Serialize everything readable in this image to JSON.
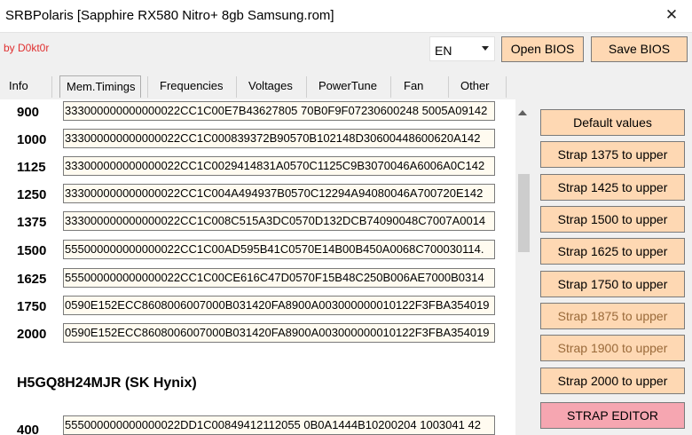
{
  "window": {
    "title": "SRBPolaris [Sapphire RX580 Nitro+ 8gb  Samsung.rom]",
    "close_glyph": "✕"
  },
  "header": {
    "author": "by D0kt0r",
    "language": "EN",
    "open_bios": "Open BIOS",
    "save_bios": "Save BIOS"
  },
  "tabs": [
    {
      "label": "Info",
      "active": false
    },
    {
      "label": "Mem.Timings",
      "active": true
    },
    {
      "label": "Frequencies",
      "active": false
    },
    {
      "label": "Voltages",
      "active": false
    },
    {
      "label": "PowerTune",
      "active": false
    },
    {
      "label": "Fan",
      "active": false
    },
    {
      "label": "Other",
      "active": false
    }
  ],
  "timings": [
    {
      "freq": "900",
      "strap": "333000000000000022CC1C00E7B43627805 70B0F9F07230600248 5005A09142"
    },
    {
      "freq": "1000",
      "strap": "333000000000000022CC1C000839372B90570B102148D30600448600620A142"
    },
    {
      "freq": "1125",
      "strap": "333000000000000022CC1C0029414831A0570C1125C9B3070046A6006A0C142"
    },
    {
      "freq": "1250",
      "strap": "333000000000000022CC1C004A494937B0570C12294A94080046A700720E142"
    },
    {
      "freq": "1375",
      "strap": "333000000000000022CC1C008C515A3DC0570D132DCB74090048C7007A0014"
    },
    {
      "freq": "1500",
      "strap": "555000000000000022CC1C00AD595B41C0570E14B00B450A0068C700030114."
    },
    {
      "freq": "1625",
      "strap": "555000000000000022CC1C00CE616C47D0570F15B48C250B006AE7000B0314"
    },
    {
      "freq": "1750",
      "strap": "0590E152ECC8608006007000B031420FA8900A003000000010122F3FBA354019"
    },
    {
      "freq": "2000",
      "strap": "0590E152ECC8608006007000B031420FA8900A003000000010122F3FBA354019"
    }
  ],
  "section_heading": "H5GQ8H24MJR (SK Hynix)",
  "hynix_timing": {
    "freq": "400",
    "strap": "555000000000000022DD1C00849412112055 0B0A1444B10200204 1003041 42"
  },
  "side_buttons": [
    {
      "label": "Default values",
      "style": "normal"
    },
    {
      "label": "Strap 1375 to upper",
      "style": "normal"
    },
    {
      "label": "Strap 1425 to upper",
      "style": "normal"
    },
    {
      "label": "Strap 1500 to upper",
      "style": "normal"
    },
    {
      "label": "Strap 1625 to upper",
      "style": "normal"
    },
    {
      "label": "Strap 1750 to upper",
      "style": "normal"
    },
    {
      "label": "Strap 1875 to upper",
      "style": "dim"
    },
    {
      "label": "Strap 1900 to upper",
      "style": "dim"
    },
    {
      "label": "Strap 2000 to upper",
      "style": "normal"
    },
    {
      "label": "STRAP EDITOR",
      "style": "editor"
    }
  ],
  "colors": {
    "button": "#fed8b3",
    "editor_button": "#f6a6b1",
    "author": "#e03030",
    "strap_field": "#fffbf0"
  }
}
